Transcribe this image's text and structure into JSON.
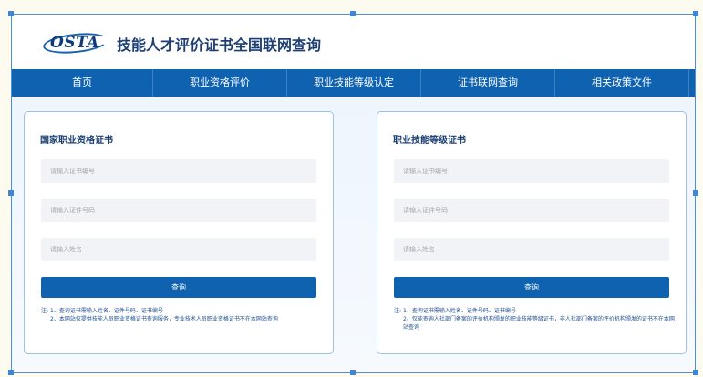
{
  "header": {
    "logo_text": "OSTA",
    "site_title": "技能人才评价证书全国联网查询"
  },
  "nav": {
    "items": [
      "首页",
      "职业资格评价",
      "职业技能等级认定",
      "证书联网查询",
      "相关政策文件"
    ]
  },
  "cards": [
    {
      "title": "国家职业资格证书",
      "cert_placeholder": "请输入证书编号",
      "id_placeholder": "请输入证件号码",
      "name_placeholder": "请输入姓名",
      "button_label": "查询",
      "note_label": "注:",
      "notes": [
        "1、查询证书需输入姓名、证件号码、证书编号",
        "2、本网站仅提供技能人员职业资格证书查询服务，专业技术人员职业资格证书不在本网站查询"
      ]
    },
    {
      "title": "职业技能等级证书",
      "cert_placeholder": "请输入证书编号",
      "id_placeholder": "请输入证件号码",
      "name_placeholder": "请输入姓名",
      "button_label": "查询",
      "note_label": "注:",
      "notes": [
        "1、查询证书需输入姓名、证件号码、证书编号",
        "2、仅能查询人社部门备案的评价机构颁发的职业技能等级证书，非人社部门备案的评价机构颁发的证书不在本网站查询"
      ]
    }
  ]
}
